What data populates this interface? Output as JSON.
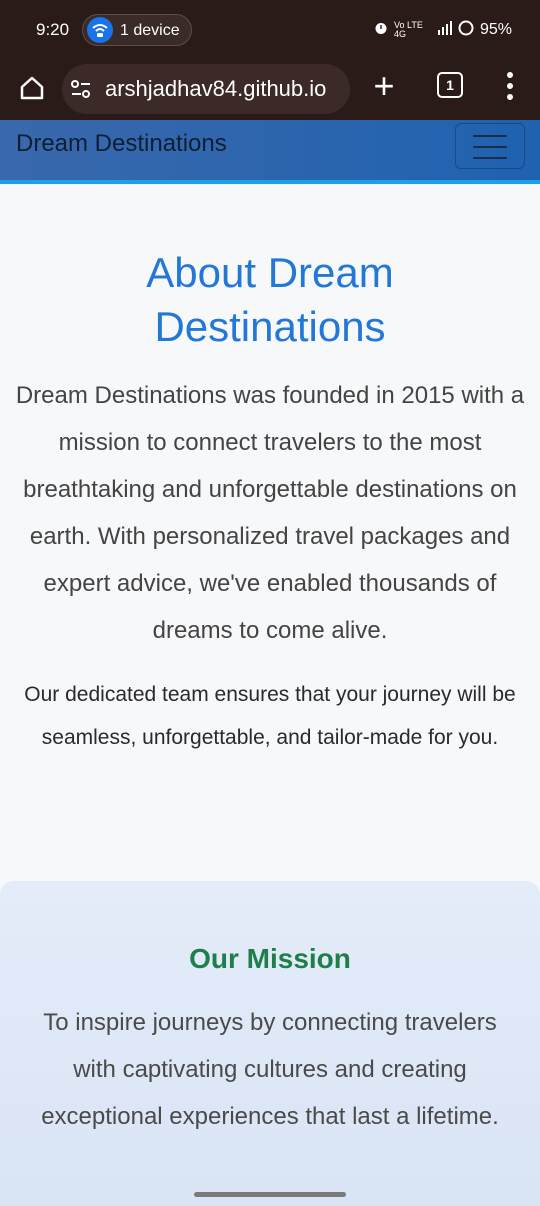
{
  "status_bar": {
    "time": "9:20",
    "chip_label": "1 device",
    "network": "Vo LTE 4G",
    "battery": "95%"
  },
  "browser": {
    "url": "arshjadhav84.github.io",
    "tab_count": "1"
  },
  "navbar": {
    "brand": "Dream Destinations"
  },
  "about": {
    "title": "About Dream Destinations",
    "paragraph1": "Dream Destinations was founded in 2015 with a mission to connect travelers to the most breathtaking and unforgettable destinations on earth. With personalized travel packages and expert advice, we've enabled thousands of dreams to come alive.",
    "paragraph2": "Our dedicated team ensures that your journey will be seamless, unforgettable, and tailor-made for you."
  },
  "mission": {
    "title": "Our Mission",
    "text": "To inspire journeys by connecting travelers with captivating cultures and creating exceptional experiences that last a lifetime."
  },
  "colors": {
    "status_bg": "#2a1b18",
    "navbar": "#2a66ae",
    "accent_blue": "#2377d6",
    "mission_green": "#1f7f4c"
  }
}
